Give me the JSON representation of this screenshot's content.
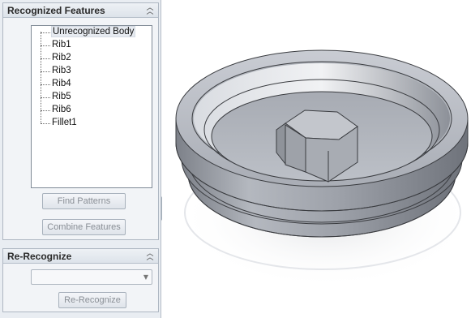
{
  "recognized_features": {
    "title": "Recognized Features",
    "items": [
      {
        "label": "Unrecognized Body"
      },
      {
        "label": "Rib1"
      },
      {
        "label": "Rib2"
      },
      {
        "label": "Rib3"
      },
      {
        "label": "Rib4"
      },
      {
        "label": "Rib5"
      },
      {
        "label": "Rib6"
      },
      {
        "label": "Fillet1"
      }
    ],
    "find_patterns_label": "Find Patterns",
    "combine_features_label": "Combine Features"
  },
  "re_recognize": {
    "title": "Re-Recognize",
    "dropdown_value": "",
    "button_label": "Re-Recognize"
  },
  "icons": {
    "collapse": "double-chevron-up-icon",
    "splitter": "splitter-arrows-icon",
    "dropdown": "chevron-down-icon"
  }
}
